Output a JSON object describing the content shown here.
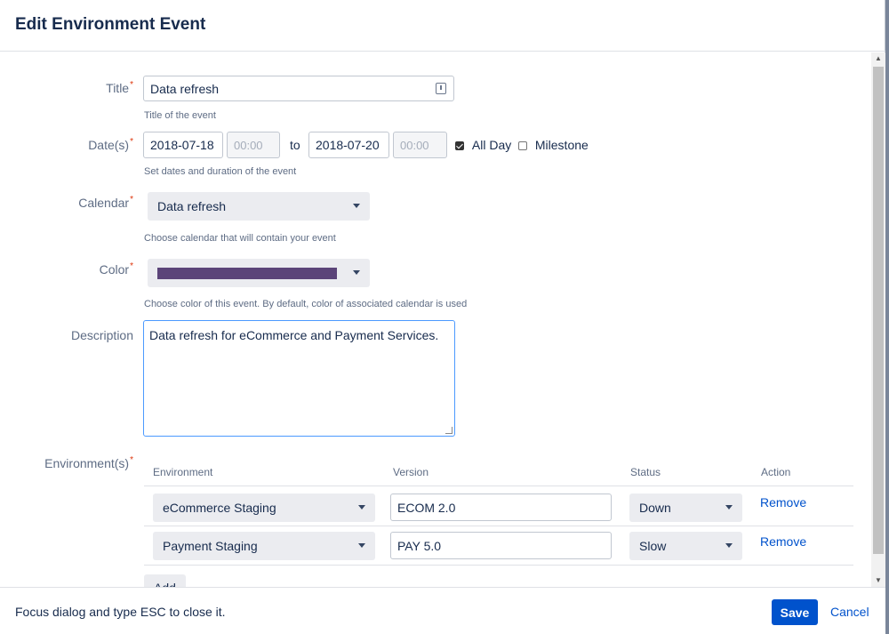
{
  "dialog": {
    "title": "Edit Environment Event"
  },
  "form": {
    "title": {
      "label": "Title",
      "value": "Data refresh",
      "help": "Title of the event"
    },
    "dates": {
      "label": "Date(s)",
      "start_date": "2018-07-18",
      "start_time": "00:00",
      "to_label": "to",
      "end_date": "2018-07-20",
      "end_time": "00:00",
      "all_day_label": "All Day",
      "all_day_checked": true,
      "milestone_label": "Milestone",
      "milestone_checked": false,
      "help": "Set dates and duration of the event"
    },
    "calendar": {
      "label": "Calendar",
      "value": "Data refresh",
      "help": "Choose calendar that will contain your event"
    },
    "color": {
      "label": "Color",
      "swatch": "#5b4479",
      "help": "Choose color of this event. By default, color of associated calendar is used"
    },
    "description": {
      "label": "Description",
      "value": "Data refresh for eCommerce and Payment Services."
    },
    "environments": {
      "label": "Environment(s)",
      "columns": {
        "environment": "Environment",
        "version": "Version",
        "status": "Status",
        "action": "Action"
      },
      "rows": [
        {
          "environment": "eCommerce Staging",
          "version": "ECOM 2.0",
          "status": "Down",
          "action": "Remove"
        },
        {
          "environment": "Payment Staging",
          "version": "PAY 5.0",
          "status": "Slow",
          "action": "Remove"
        }
      ],
      "add_label": "Add"
    },
    "required_mark": "*"
  },
  "footer": {
    "hint": "Focus dialog and type ESC to close it.",
    "save_label": "Save",
    "cancel_label": "Cancel"
  },
  "colors": {
    "primary": "#0052cc",
    "required": "#de350b",
    "focus": "#4c9aff"
  }
}
